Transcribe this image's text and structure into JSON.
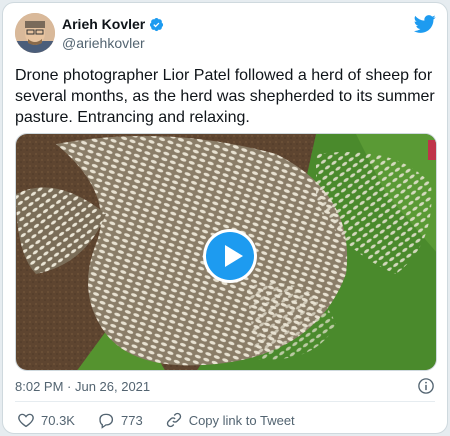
{
  "author": {
    "display_name": "Arieh Kovler",
    "handle": "@ariehkovler",
    "verified": true
  },
  "tweet": {
    "text": "Drone photographer Lior Patel followed a herd of sheep for several months, as the herd was shepherded to its summer pasture. Entrancing and relaxing.",
    "timestamp": "8:02 PM · Jun 26, 2021"
  },
  "actions": {
    "likes": "70.3K",
    "replies": "773",
    "copy_link_label": "Copy link to Tweet"
  },
  "icons": [
    "twitter-bird-icon",
    "verified-badge-icon",
    "play-icon",
    "info-icon",
    "heart-icon",
    "reply-icon",
    "link-icon"
  ],
  "colors": {
    "accent": "#1d9bf0",
    "text": "#0f1419",
    "secondary": "#536471"
  }
}
